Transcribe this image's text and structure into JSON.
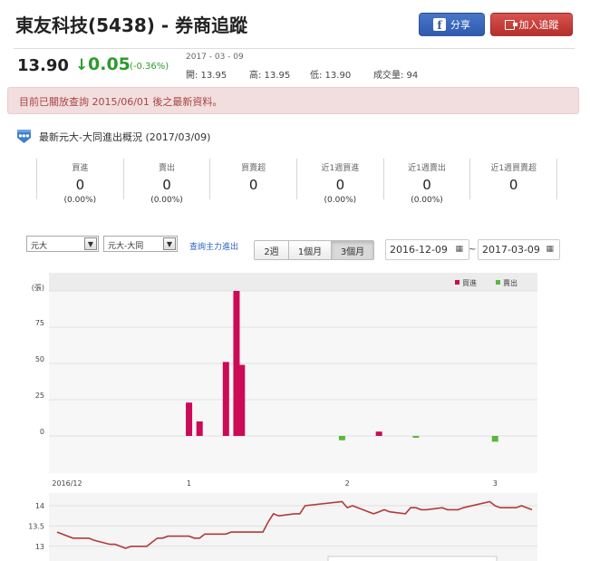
{
  "header": {
    "title": "東友科技(5438) - 券商追蹤",
    "share_label": "分享",
    "add_label": "加入追蹤"
  },
  "quote": {
    "price": "13.90",
    "change": "0.05",
    "change_pct": "(-0.36%)",
    "date": "2017 - 03 - 09",
    "open": "開: 13.95",
    "high": "高: 13.95",
    "low": "低: 13.90",
    "volume": "成交量: 94",
    "change_color": "#2e9a2e"
  },
  "alert": {
    "text": "目前已關放查詢 2015/06/01 後之最新資料。"
  },
  "section": {
    "title": "最新元大-大同進出概況 (2017/03/09)"
  },
  "stats": [
    {
      "label": "買進",
      "value": "0",
      "pct": "(0.00%)"
    },
    {
      "label": "賣出",
      "value": "0",
      "pct": "(0.00%)"
    },
    {
      "label": "買賣超",
      "value": "0",
      "pct": ""
    },
    {
      "label": "近1週買進",
      "value": "0",
      "pct": "(0.00%)"
    },
    {
      "label": "近1週賣出",
      "value": "0",
      "pct": "(0.00%)"
    },
    {
      "label": "近1週買賣超",
      "value": "0",
      "pct": ""
    }
  ],
  "controls": {
    "broker_select": "元大",
    "branch_select": "元大-大同",
    "query_link": "查詢主力進出",
    "ranges": [
      "2週",
      "1個月",
      "3個月"
    ],
    "active_range": "3個月",
    "date_from": "2016-12-09",
    "date_to": "2017-03-09",
    "date_sep": "~",
    "cal_icon": "calendar-icon"
  },
  "chart_data": [
    {
      "type": "bar",
      "ylabel": "(張)",
      "ylim": [
        -10,
        100
      ],
      "yticks": [
        0,
        25,
        50,
        75
      ],
      "ytick_labels": [
        "0",
        "25",
        "50",
        "75"
      ],
      "xticks": [
        {
          "label": "2016/12",
          "x": "2016-12-09"
        },
        {
          "label": "1",
          "x": "2017-01-03"
        },
        {
          "label": "2",
          "x": "2017-02-02"
        },
        {
          "label": "3",
          "x": "2017-03-02"
        }
      ],
      "legend": [
        {
          "name": "買進",
          "color": "#cc0a55"
        },
        {
          "name": "賣出",
          "color": "#58b83a"
        }
      ],
      "legend_position": "top-right",
      "series": [
        {
          "name": "買進",
          "color": "#cc0a55",
          "points": [
            {
              "x": "2017-01-03",
              "y": 23
            },
            {
              "x": "2017-01-05",
              "y": 10
            },
            {
              "x": "2017-01-10",
              "y": 51
            },
            {
              "x": "2017-01-12",
              "y": 100
            },
            {
              "x": "2017-01-13",
              "y": 49
            },
            {
              "x": "2017-02-08",
              "y": 3
            }
          ]
        },
        {
          "name": "賣出",
          "color": "#58b83a",
          "points": [
            {
              "x": "2017-02-01",
              "y": -3
            },
            {
              "x": "2017-02-15",
              "y": -1
            },
            {
              "x": "2017-03-02",
              "y": -4
            }
          ]
        }
      ]
    },
    {
      "type": "line",
      "ylim": [
        12.75,
        14.2
      ],
      "yticks": [
        13,
        13.5,
        14
      ],
      "ytick_labels": [
        "13",
        "13.5",
        "14"
      ],
      "color": "#b23a3a",
      "x": [
        "2016-12-09",
        "2016-12-12",
        "2016-12-13",
        "2016-12-14",
        "2016-12-15",
        "2016-12-16",
        "2016-12-19",
        "2016-12-20",
        "2016-12-21",
        "2016-12-22",
        "2016-12-23",
        "2016-12-26",
        "2016-12-27",
        "2016-12-28",
        "2016-12-29",
        "2016-12-30",
        "2017-01-03",
        "2017-01-04",
        "2017-01-05",
        "2017-01-06",
        "2017-01-09",
        "2017-01-10",
        "2017-01-11",
        "2017-01-12",
        "2017-01-13",
        "2017-01-16",
        "2017-01-17",
        "2017-01-18",
        "2017-01-19",
        "2017-01-20",
        "2017-01-23",
        "2017-01-24",
        "2017-01-25",
        "2017-02-01",
        "2017-02-02",
        "2017-02-03",
        "2017-02-06",
        "2017-02-07",
        "2017-02-08",
        "2017-02-09",
        "2017-02-10",
        "2017-02-13",
        "2017-02-14",
        "2017-02-15",
        "2017-02-16",
        "2017-02-17",
        "2017-02-20",
        "2017-02-21",
        "2017-02-22",
        "2017-02-23",
        "2017-02-24",
        "2017-03-01",
        "2017-03-02",
        "2017-03-03",
        "2017-03-06",
        "2017-03-07",
        "2017-03-08",
        "2017-03-09"
      ],
      "values": [
        13.35,
        13.2,
        13.2,
        13.2,
        13.2,
        13.15,
        13.05,
        13.05,
        13.0,
        12.95,
        13.0,
        13.0,
        13.1,
        13.2,
        13.2,
        13.25,
        13.25,
        13.2,
        13.2,
        13.3,
        13.3,
        13.3,
        13.35,
        13.35,
        13.35,
        13.35,
        13.35,
        13.6,
        13.8,
        13.75,
        13.8,
        13.8,
        14.0,
        14.1,
        13.95,
        14.0,
        13.85,
        13.8,
        13.85,
        13.9,
        13.85,
        13.8,
        13.95,
        13.95,
        13.9,
        13.9,
        13.95,
        13.9,
        13.9,
        13.9,
        13.95,
        14.1,
        14.0,
        13.95,
        13.95,
        14.0,
        13.95,
        13.9
      ]
    }
  ]
}
